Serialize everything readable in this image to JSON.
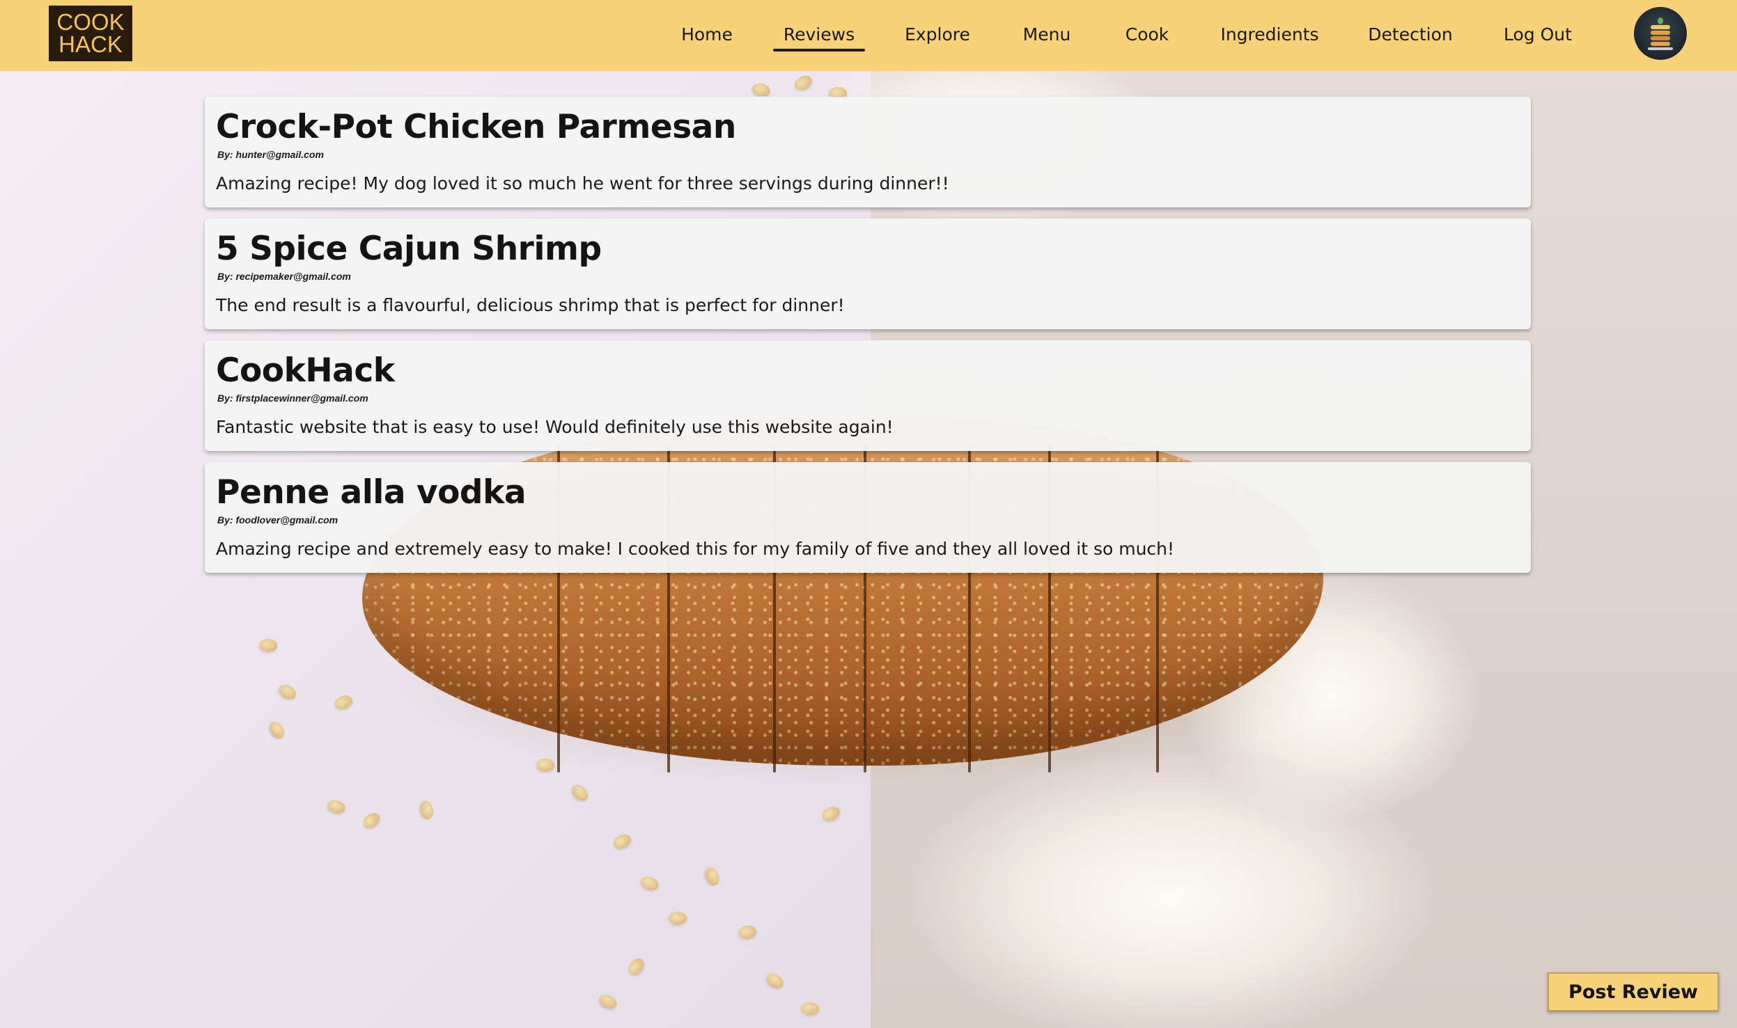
{
  "brand": {
    "logo_line1": "COOK",
    "logo_line2": "HACK",
    "accent_color": "#f8d27a",
    "logo_bg_color": "#2a1c0c"
  },
  "nav": {
    "items": [
      {
        "label": "Home",
        "active": false
      },
      {
        "label": "Reviews",
        "active": true
      },
      {
        "label": "Explore",
        "active": false
      },
      {
        "label": "Menu",
        "active": false
      },
      {
        "label": "Cook",
        "active": false
      },
      {
        "label": "Ingredients",
        "active": false
      },
      {
        "label": "Detection",
        "active": false
      },
      {
        "label": "Log Out",
        "active": false
      }
    ],
    "avatar_icon": "profile-avatar-icon"
  },
  "reviews": [
    {
      "title": "Crock-Pot Chicken Parmesan",
      "author": "By: hunter@gmail.com",
      "text": "Amazing recipe! My dog loved it so much he went for three servings during dinner!!"
    },
    {
      "title": "5 Spice Cajun Shrimp",
      "author": "By: recipemaker@gmail.com",
      "text": "The end result is a flavourful, delicious shrimp that is perfect for dinner!"
    },
    {
      "title": "CookHack",
      "author": "By: firstplacewinner@gmail.com",
      "text": "Fantastic website that is easy to use! Would definitely use this website again!"
    },
    {
      "title": "Penne alla vodka",
      "author": "By: foodlover@gmail.com",
      "text": "Amazing recipe and extremely easy to make! I cooked this for my family of five and they all loved it so much!"
    }
  ],
  "actions": {
    "post_review_label": "Post Review"
  }
}
